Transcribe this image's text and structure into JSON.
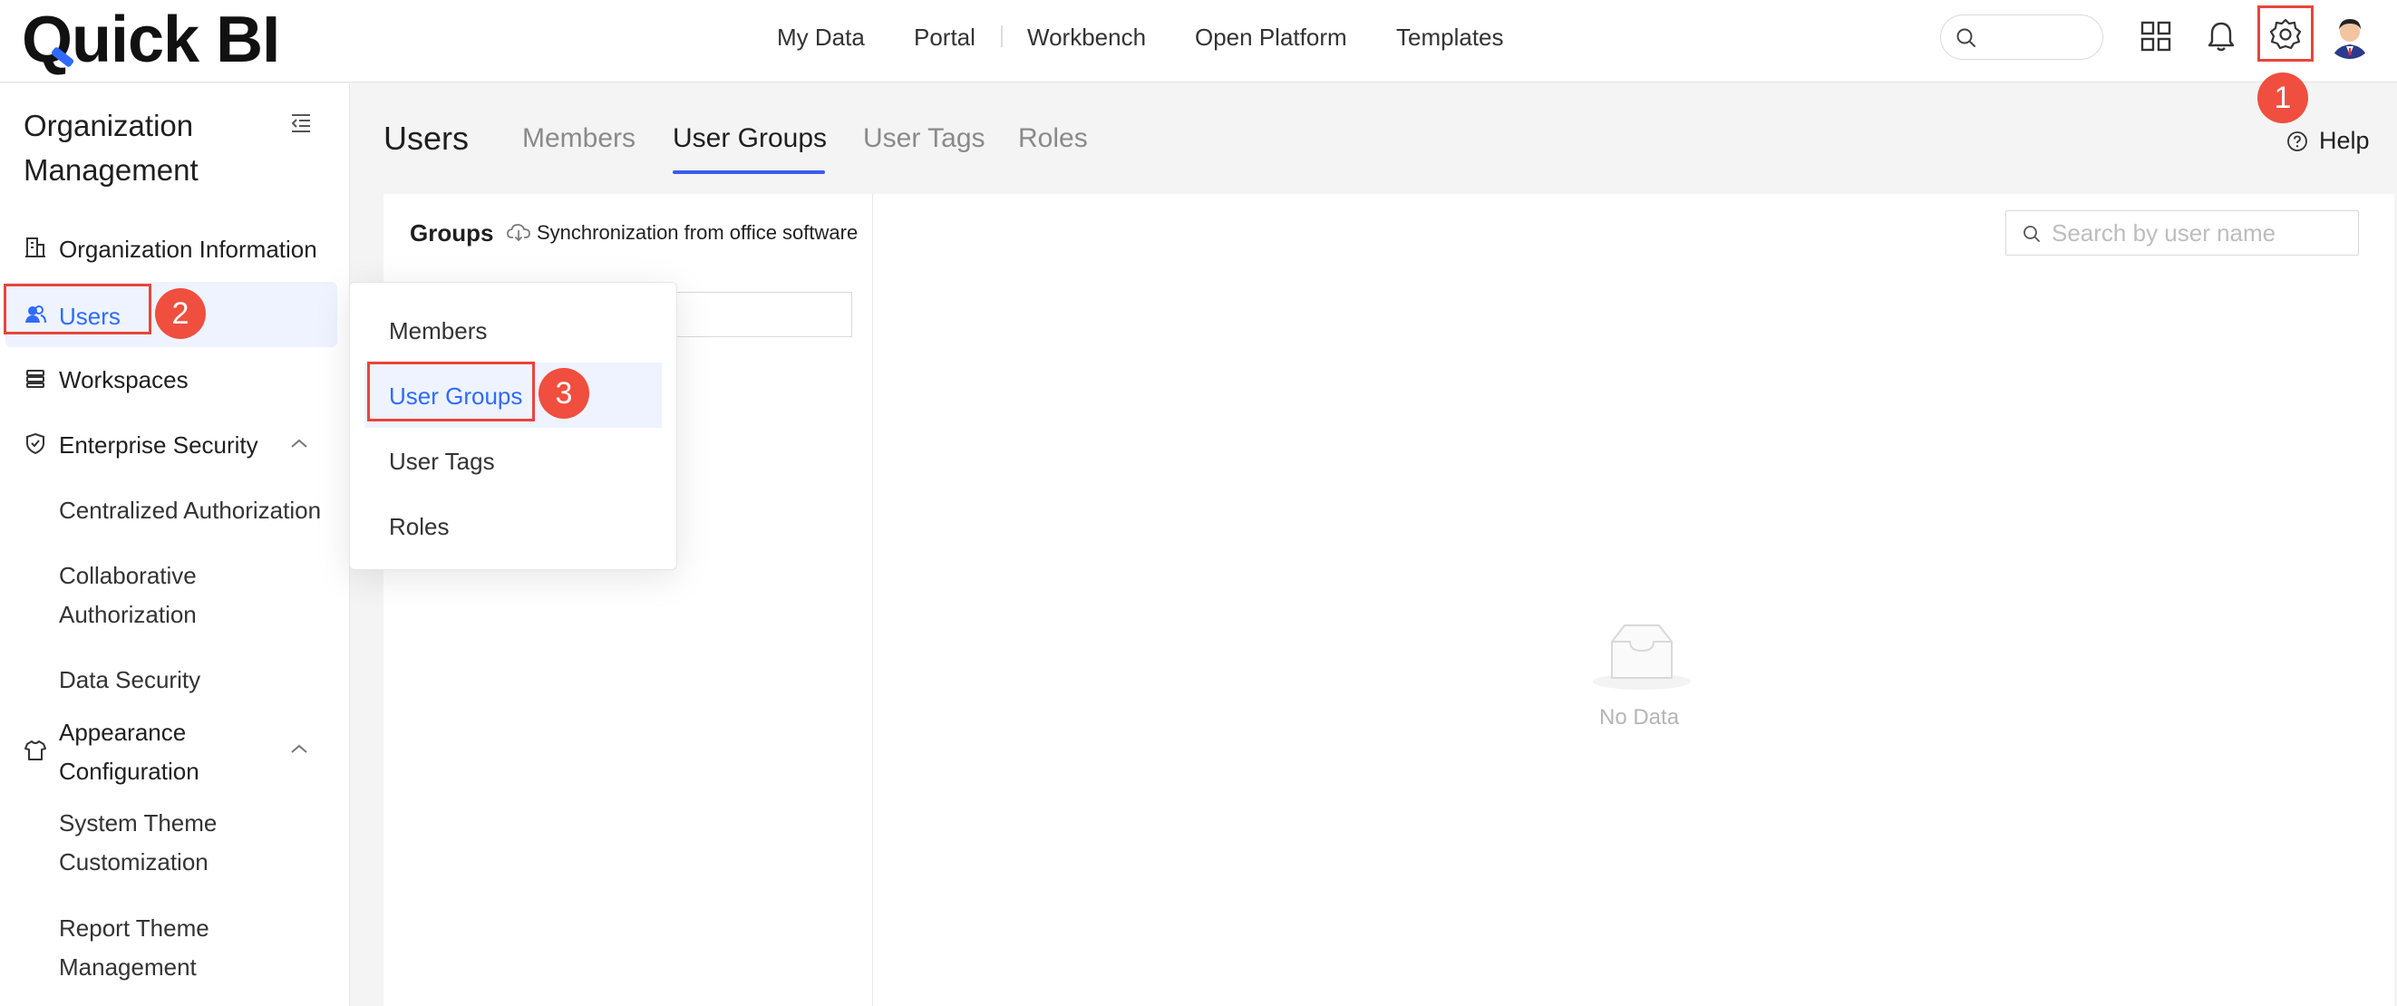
{
  "brand": {
    "logo_text": "Quick BI",
    "accent": "#2f6bff",
    "highlight_red": "#e8453c"
  },
  "topnav": {
    "items": [
      {
        "label": "My Data"
      },
      {
        "label": "Portal"
      },
      {
        "label": "Workbench"
      },
      {
        "label": "Open Platform"
      },
      {
        "label": "Templates"
      }
    ],
    "icons": [
      "search-icon",
      "apps-grid-icon",
      "bell-icon",
      "gear-icon",
      "avatar"
    ]
  },
  "sidebar": {
    "title_line1": "Organization",
    "title_line2": "Management",
    "items": [
      {
        "label": "Organization Information",
        "icon": "building-icon"
      },
      {
        "label": "Users",
        "icon": "users-icon",
        "active": true
      },
      {
        "label": "Workspaces",
        "icon": "layers-icon"
      },
      {
        "label": "Enterprise Security",
        "icon": "shield-icon",
        "expanded": true
      },
      {
        "label": "Centralized Authorization"
      },
      {
        "label_line1": "Collaborative",
        "label_line2": "Authorization"
      },
      {
        "label": "Data Security"
      },
      {
        "label_line1": "Appearance",
        "label_line2": "Configuration",
        "icon": "shirt-icon",
        "expanded": true
      },
      {
        "label_line1": "System Theme",
        "label_line2": "Customization"
      },
      {
        "label_line1": "Report Theme",
        "label_line2": "Management"
      }
    ]
  },
  "main": {
    "title": "Users",
    "tabs": [
      {
        "label": "Members"
      },
      {
        "label": "User Groups",
        "active": true
      },
      {
        "label": "User Tags"
      },
      {
        "label": "Roles"
      }
    ],
    "help_label": "Help",
    "groups_label": "Groups",
    "sync_label": "Synchronization from office software",
    "user_search_placeholder": "Search by user name",
    "empty_text": "No Data"
  },
  "dropdown": {
    "items": [
      {
        "label": "Members"
      },
      {
        "label": "User Groups",
        "active": true
      },
      {
        "label": "User Tags"
      },
      {
        "label": "Roles"
      }
    ]
  },
  "steps": [
    "1",
    "2",
    "3"
  ]
}
